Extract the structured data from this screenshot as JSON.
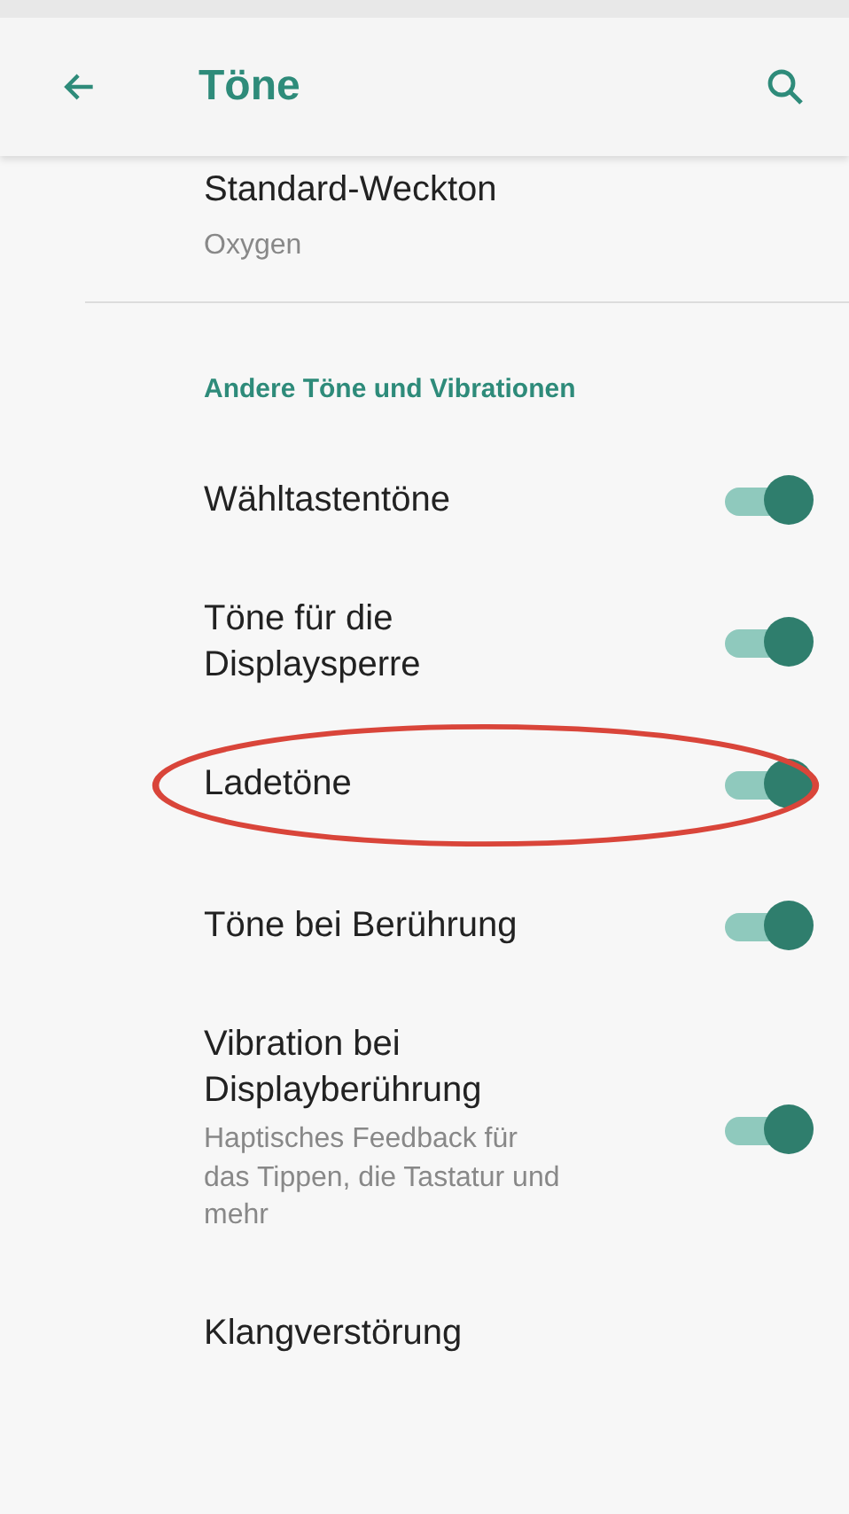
{
  "app_bar": {
    "title": "Töne"
  },
  "top_item": {
    "title": "Standard-Weckton",
    "summary": "Oxygen"
  },
  "section": {
    "title": "Andere Töne und Vibrationen"
  },
  "items": [
    {
      "kind": "switch",
      "title": "Wähltastentöne",
      "on": true,
      "highlighted": false
    },
    {
      "kind": "switch",
      "title": "Töne für die Displaysperre",
      "on": true,
      "highlighted": false
    },
    {
      "kind": "switch",
      "title": "Ladetöne",
      "on": true,
      "highlighted": true
    },
    {
      "kind": "switch",
      "title": "Töne bei Berührung",
      "on": true,
      "highlighted": false
    },
    {
      "kind": "switch",
      "title": "Vibration bei Displayberührung",
      "summary": "Haptisches Feedback für das Tippen, die Tastatur und mehr",
      "on": true,
      "highlighted": false
    },
    {
      "kind": "link",
      "title": "Klangverstörung",
      "highlighted": false
    }
  ]
}
